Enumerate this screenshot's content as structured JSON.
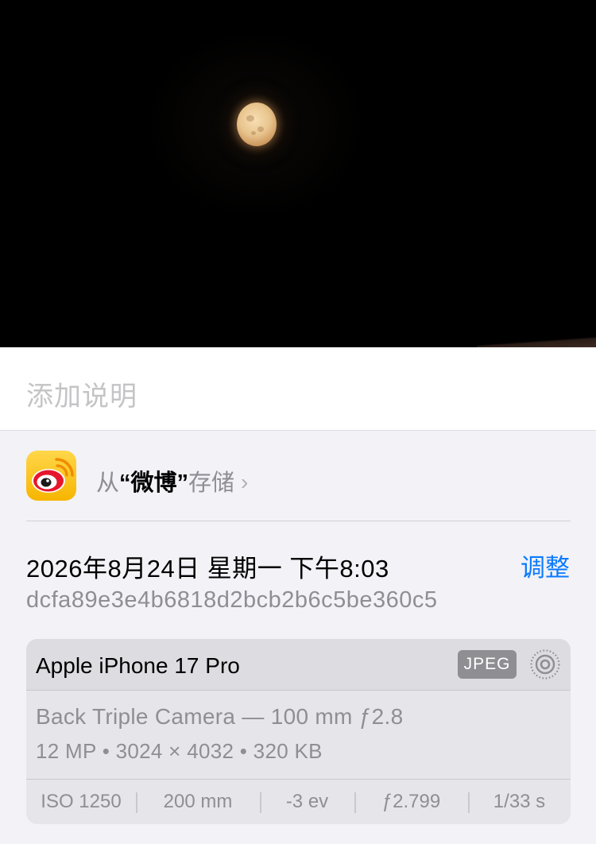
{
  "photo": {
    "subject": "moon-photo"
  },
  "caption": {
    "placeholder": "添加说明"
  },
  "source": {
    "prefix": "从",
    "app_name": "“微博”",
    "suffix": "存储",
    "app_icon": "weibo-app-icon",
    "chevron": "›"
  },
  "info": {
    "datetime": "2026年8月24日 星期一 下午8:03",
    "adjust_label": "调整",
    "filename": "dcfa89e3e4b6818d2bcb2b6c5be360c5"
  },
  "metadata": {
    "device": "Apple iPhone 17 Pro",
    "format": "JPEG",
    "live_icon": "live-photo-icon",
    "lens": "Back Triple Camera — 100 mm ƒ2.8",
    "specs": "12 MP  •  3024 × 4032  •  320 KB",
    "exif": {
      "iso": "ISO 1250",
      "focal_length": "200 mm",
      "exposure_bias": "-3 ev",
      "aperture": "ƒ2.799",
      "shutter": "1/33 s"
    }
  },
  "colors": {
    "accent": "#0a7aff",
    "secondary_text": "#8e8e93",
    "card_bg": "#e5e5ea",
    "icon_yellow": "#f7b500",
    "weibo_red": "#e6162d"
  }
}
